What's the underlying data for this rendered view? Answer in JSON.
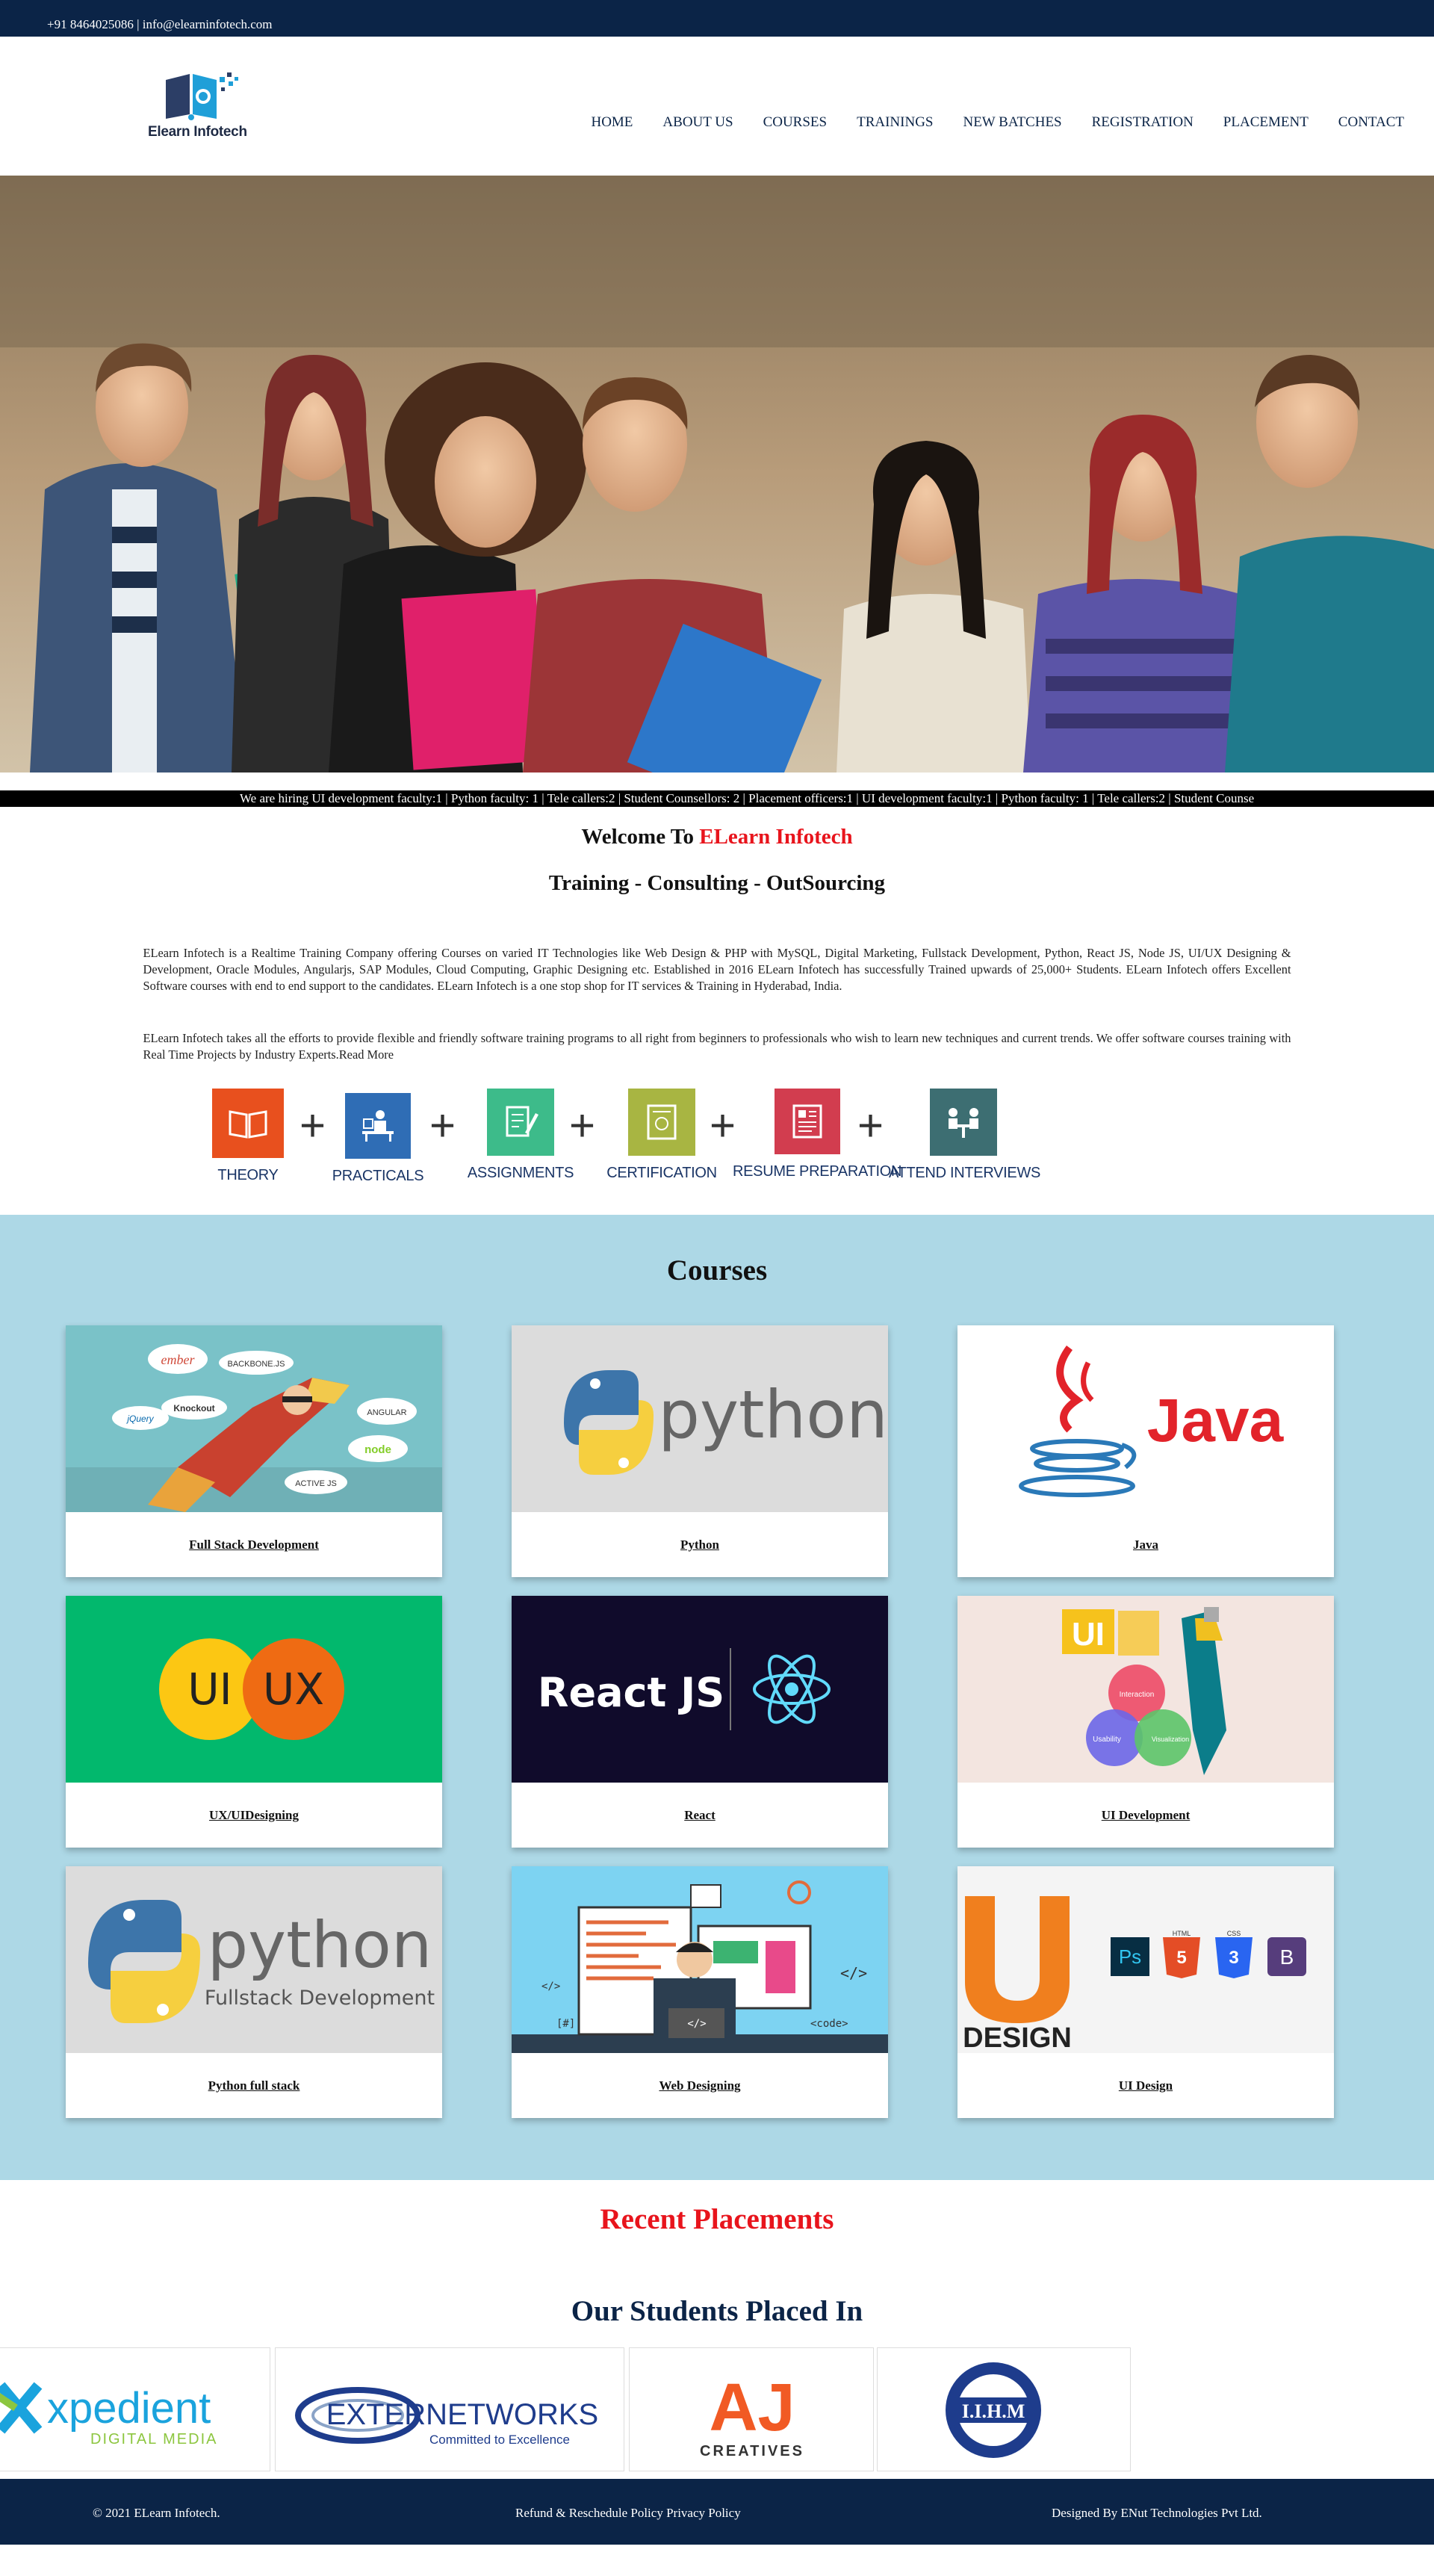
{
  "topbar": {
    "contact": "+91 8464025086 | info@elearninfotech.com"
  },
  "header": {
    "logo_text": "Elearn Infotech",
    "nav": [
      "HOME",
      "ABOUT US",
      "COURSES",
      "TRAININGS",
      "NEW BATCHES",
      "REGISTRATION",
      "PLACEMENT",
      "CONTACT"
    ]
  },
  "ticker": {
    "text": "We are hiring UI development faculty:1 | Python faculty: 1 | Tele callers:2 | Student Counsellors: 2 | Placement officers:1 | UI development faculty:1 | Python faculty: 1 | Tele callers:2 | Student Counse"
  },
  "welcome": {
    "prefix": "Welcome To",
    "brand": "ELearn Infotech",
    "tagline": "Training - Consulting - OutSourcing",
    "para1": "ELearn Infotech is a Realtime Training Company offering Courses on varied IT Technologies like Web Design & PHP with MySQL, Digital Marketing, Fullstack Development, Python, React JS, Node JS, UI/UX Designing & Development, Oracle Modules, Angularjs, SAP Modules, Cloud Computing, Graphic Designing etc. Established in 2016 ELearn Infotech has successfully Trained upwards of 25,000+ Students. ELearn Infotech offers Excellent Software courses with end to end support to the candidates. ELearn Infotech is a one stop shop for IT services & Training in Hyderabad, India.",
    "para2": "ELearn Infotech takes all the efforts to provide flexible and friendly software training programs to all right from beginners to professionals who wish to learn new techniques and current trends. We offer software courses training with Real Time Projects by Industry Experts.Read More"
  },
  "process": {
    "steps": [
      "THEORY",
      "PRACTICALS",
      "ASSIGNMENTS",
      "CERTIFICATION",
      "RESUME PREPARATION",
      "ATTEND INTERVIEWS"
    ],
    "colors": [
      "#e8501e",
      "#2f6db5",
      "#3dbb8a",
      "#a8b542",
      "#d23d4f",
      "#3d6e72"
    ],
    "plus": "+"
  },
  "courses": {
    "title": "Courses",
    "items": [
      "Full Stack Development",
      "Python",
      "Java",
      "UX/UIDesigning",
      "React",
      "UI Development",
      "Python full stack",
      "Web Designing",
      "UI Design"
    ],
    "art_text": {
      "python": "python",
      "java": "Java",
      "ui": "UI",
      "ux": "UX",
      "react": "React JS",
      "python_fs_sub": "Fullstack Development",
      "design": "DESIGN",
      "ember": "ember",
      "backbone": "BACKBONE.JS",
      "knockout": "Knockout",
      "jquery": "jQuery",
      "angular": "ANGULAR",
      "node": "node",
      "active": "ACTIVE JS",
      "interaction": "Interaction",
      "usability": "Usability",
      "visualization": "Visualization",
      "ps": "Ps",
      "boot": "B",
      "html": "HTML",
      "css": "CSS",
      "code": "<code>",
      "hash": "[#]",
      "tag": "</>"
    }
  },
  "placements": {
    "title": "Recent Placements",
    "subtitle": "Our Students Placed In",
    "logos": {
      "xpedient": "xpedient",
      "xpedient_sub": "DIGITAL MEDIA",
      "extern": "EXTERNETWORKS",
      "extern_sub": "Committed to Excellence",
      "aj": "AJ",
      "aj_sub": "CREATIVES",
      "iihm": "I.I.H.M"
    }
  },
  "footer": {
    "copyright": "© 2021 ELearn Infotech.",
    "policy": "Refund & Reschedule Policy Privacy Policy",
    "designer": "Designed By ENut Technologies Pvt Ltd."
  }
}
